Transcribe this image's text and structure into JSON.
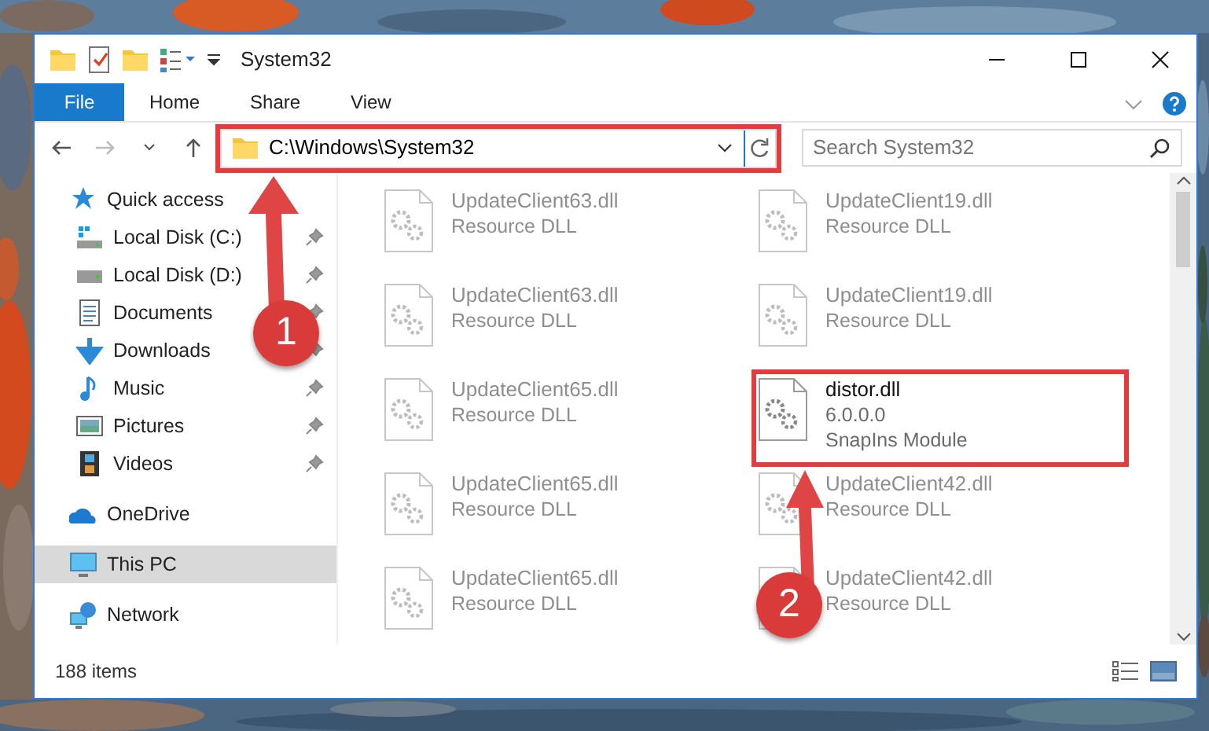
{
  "window": {
    "title": "System32"
  },
  "ribbon_tabs": [
    {
      "label": "File",
      "kind": "menu"
    },
    {
      "label": "Home",
      "kind": "tab"
    },
    {
      "label": "Share",
      "kind": "tab"
    },
    {
      "label": "View",
      "kind": "tab"
    }
  ],
  "address": {
    "path": "C:\\Windows\\System32"
  },
  "search": {
    "placeholder": "Search System32"
  },
  "sidebar": {
    "items": [
      {
        "label": "Quick access",
        "selected": false,
        "children": [
          {
            "label": "Local Disk (C:)",
            "pinned": true,
            "selected": false
          },
          {
            "label": "Local Disk (D:)",
            "pinned": true,
            "selected": false
          },
          {
            "label": "Documents",
            "pinned": true,
            "selected": false
          },
          {
            "label": "Downloads",
            "pinned": true,
            "selected": false
          },
          {
            "label": "Music",
            "pinned": true,
            "selected": false
          },
          {
            "label": "Pictures",
            "pinned": true,
            "selected": false
          },
          {
            "label": "Videos",
            "pinned": true,
            "selected": false
          }
        ]
      },
      {
        "label": "OneDrive",
        "selected": false
      },
      {
        "label": "This PC",
        "selected": true
      },
      {
        "label": "Network",
        "selected": false
      }
    ]
  },
  "files": [
    {
      "name": "UpdateClient63.dll",
      "details": [
        "Resource DLL"
      ],
      "dimmed": true
    },
    {
      "name": "UpdateClient19.dll",
      "details": [
        "Resource DLL"
      ],
      "dimmed": true
    },
    {
      "name": "UpdateClient63.dll",
      "details": [
        "Resource DLL"
      ],
      "dimmed": true
    },
    {
      "name": "UpdateClient19.dll",
      "details": [
        "Resource DLL"
      ],
      "dimmed": true
    },
    {
      "name": "UpdateClient65.dll",
      "details": [
        "Resource DLL"
      ],
      "dimmed": true
    },
    {
      "name": "distor.dll",
      "details": [
        "6.0.0.0",
        "SnapIns Module"
      ],
      "dimmed": false
    },
    {
      "name": "UpdateClient65.dll",
      "details": [
        "Resource DLL"
      ],
      "dimmed": true
    },
    {
      "name": "UpdateClient42.dll",
      "details": [
        "Resource DLL"
      ],
      "dimmed": true
    },
    {
      "name": "UpdateClient65.dll",
      "details": [
        "Resource DLL"
      ],
      "dimmed": true
    },
    {
      "name": "UpdateClient42.dll",
      "details": [
        "Resource DLL"
      ],
      "dimmed": true
    }
  ],
  "status_bar": {
    "item_count": "188 items"
  },
  "callouts": [
    {
      "number": "1"
    },
    {
      "number": "2"
    }
  ]
}
